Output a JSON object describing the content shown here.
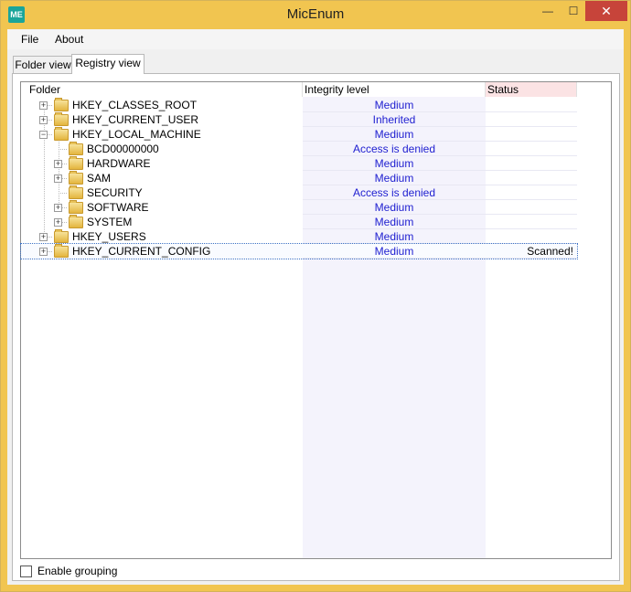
{
  "window": {
    "title": "MicEnum",
    "icon_label": "ME",
    "minimize_label": "—",
    "maximize_label": "☐",
    "close_label": "✕"
  },
  "menu": [
    {
      "label": "File"
    },
    {
      "label": "About"
    }
  ],
  "tabs": [
    {
      "label": "Folder view",
      "active": false
    },
    {
      "label": "Registry view",
      "active": true
    }
  ],
  "columns": {
    "folder": "Folder",
    "integrity": "Integrity level",
    "status": "Status"
  },
  "rows": [
    {
      "name": "HKEY_CLASSES_ROOT",
      "integrity": "Medium",
      "status": "",
      "depth": 0,
      "expander": "plus"
    },
    {
      "name": "HKEY_CURRENT_USER",
      "integrity": "Inherited",
      "status": "",
      "depth": 0,
      "expander": "plus"
    },
    {
      "name": "HKEY_LOCAL_MACHINE",
      "integrity": "Medium",
      "status": "",
      "depth": 0,
      "expander": "minus"
    },
    {
      "name": "BCD00000000",
      "integrity": "Access is denied",
      "status": "",
      "depth": 1,
      "expander": "none"
    },
    {
      "name": "HARDWARE",
      "integrity": "Medium",
      "status": "",
      "depth": 1,
      "expander": "plus"
    },
    {
      "name": "SAM",
      "integrity": "Medium",
      "status": "",
      "depth": 1,
      "expander": "plus"
    },
    {
      "name": "SECURITY",
      "integrity": "Access is denied",
      "status": "",
      "depth": 1,
      "expander": "none"
    },
    {
      "name": "SOFTWARE",
      "integrity": "Medium",
      "status": "",
      "depth": 1,
      "expander": "plus"
    },
    {
      "name": "SYSTEM",
      "integrity": "Medium",
      "status": "",
      "depth": 1,
      "expander": "plus"
    },
    {
      "name": "HKEY_USERS",
      "integrity": "Medium",
      "status": "",
      "depth": 0,
      "expander": "plus"
    },
    {
      "name": "HKEY_CURRENT_CONFIG",
      "integrity": "Medium",
      "status": "Scanned!",
      "depth": 0,
      "expander": "plus",
      "selected": true
    }
  ],
  "grouping": {
    "label": "Enable grouping",
    "checked": false
  }
}
